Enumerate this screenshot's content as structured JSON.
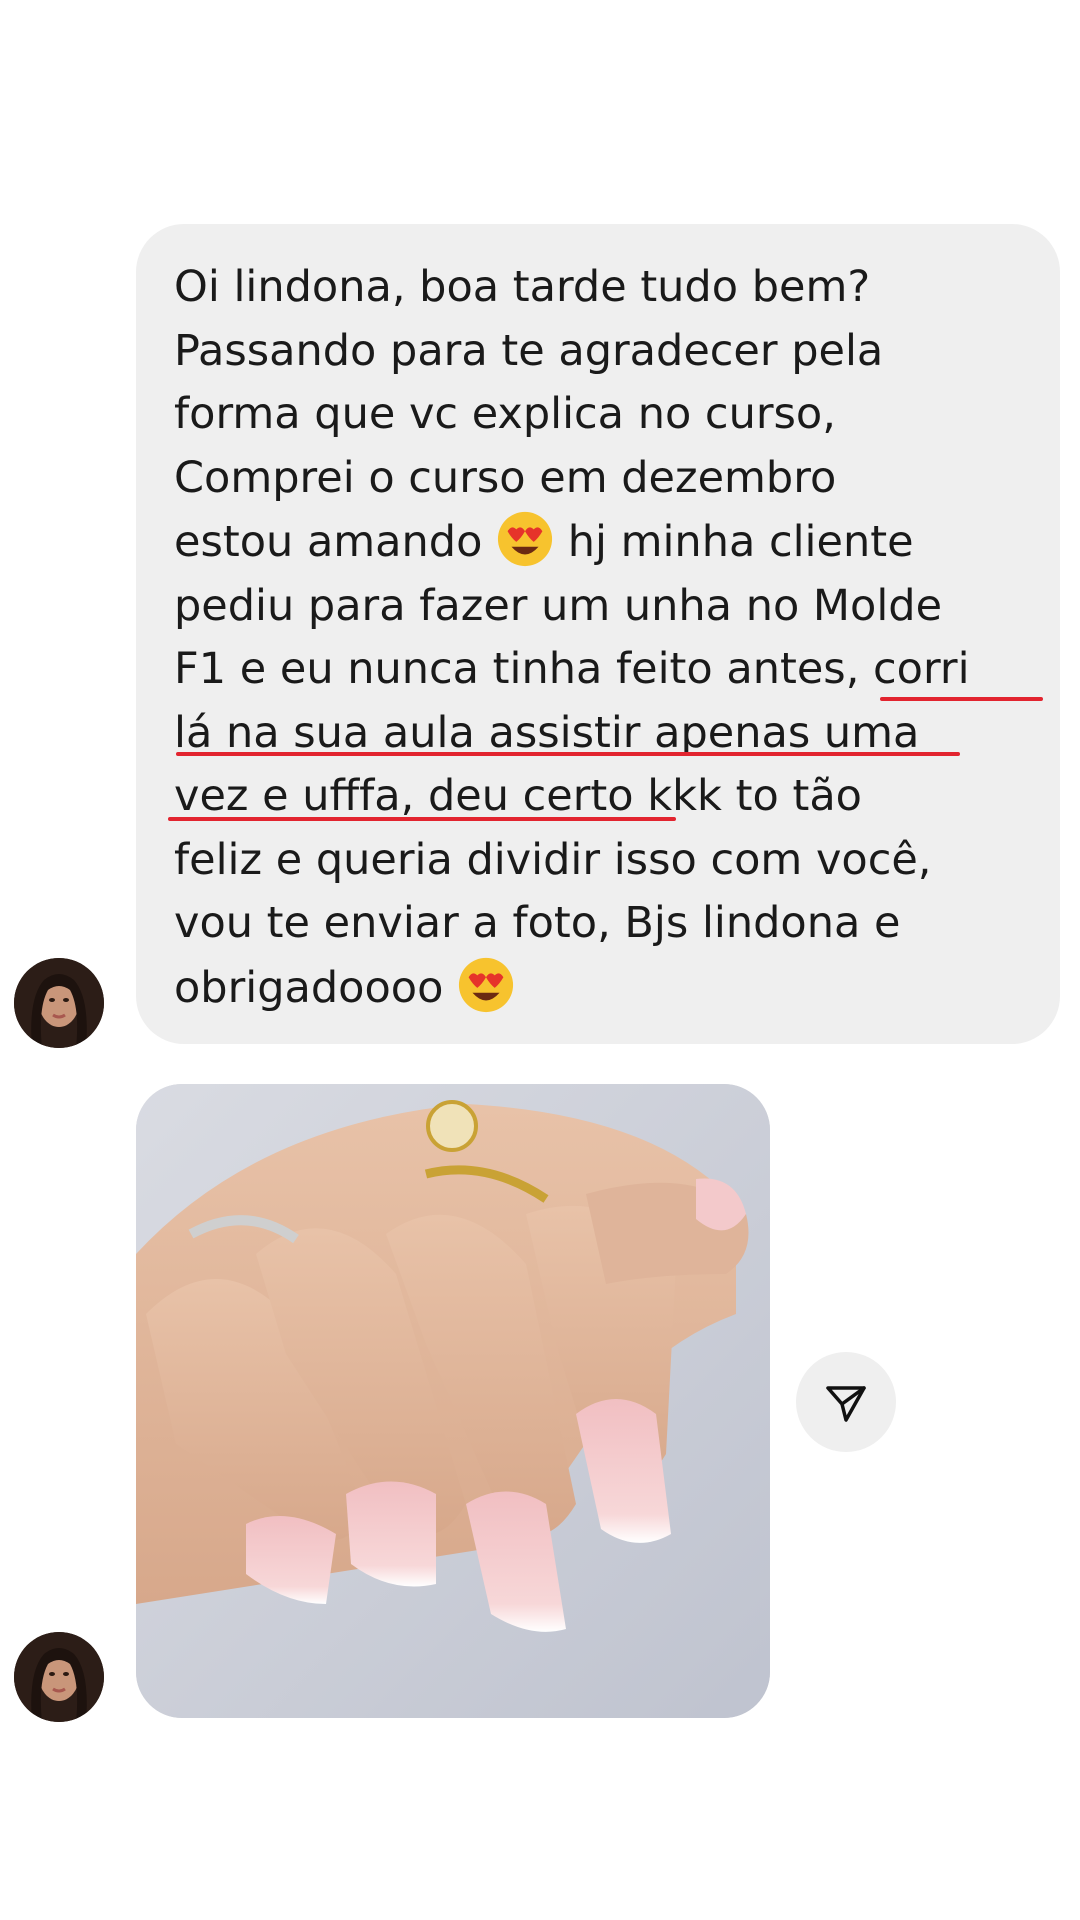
{
  "message": {
    "lines": [
      "Oi lindona, boa tarde tudo bem?",
      "Passando para te agradecer pela",
      "forma que vc explica no curso,",
      "Comprei o curso em dezembro",
      "estou amando",
      "hj minha cliente",
      "pediu para fazer um unha no Molde",
      "F1 e eu nunca tinha feito antes, corri",
      "lá na sua aula assistir apenas uma",
      "vez e ufffa, deu certo kkk to tão",
      "feliz e queria dividir isso com você,",
      "vou te enviar a foto, Bjs lindona e",
      "obrigadoooo"
    ],
    "emoji": "heart-eyes-emoji",
    "underline_color": "#e2242f"
  },
  "photo": {
    "icon": "nail-photo"
  },
  "share": {
    "icon": "share-paper-plane-icon"
  },
  "colors": {
    "bubble": "#efefef",
    "text": "#1a1a1a",
    "background": "#ffffff"
  }
}
